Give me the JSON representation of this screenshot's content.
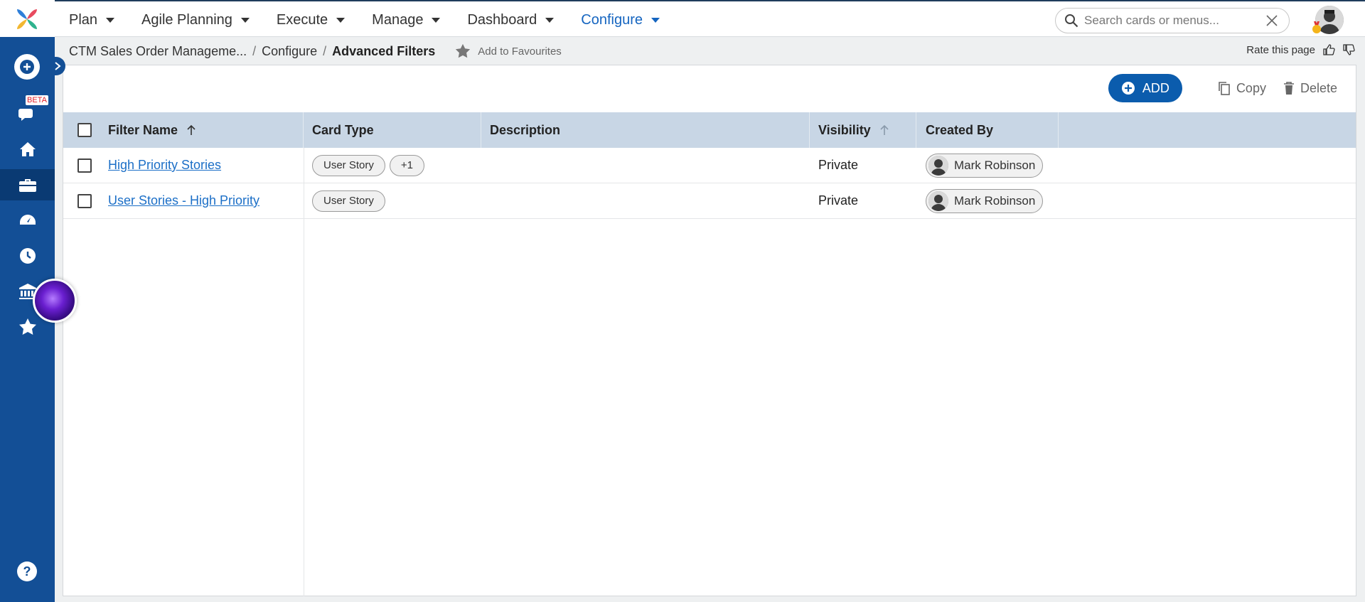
{
  "nav": {
    "menu": [
      {
        "label": "Plan",
        "active": false
      },
      {
        "label": "Agile Planning",
        "active": false
      },
      {
        "label": "Execute",
        "active": false
      },
      {
        "label": "Manage",
        "active": false
      },
      {
        "label": "Dashboard",
        "active": false
      },
      {
        "label": "Configure",
        "active": true
      }
    ],
    "search": {
      "placeholder": "Search cards or menus..."
    }
  },
  "sidebar": {
    "beta_label": "BETA",
    "icons": [
      "add-circle-icon",
      "chat-bubbles-icon",
      "home-icon",
      "briefcase-icon",
      "dashboard-gauge-icon",
      "clock-icon",
      "bank-icon",
      "star-icon",
      "help-icon"
    ],
    "active_icon": "briefcase-icon",
    "help_label": "?"
  },
  "breadcrumb": {
    "items": [
      "CTM Sales Order Manageme...",
      "Configure",
      "Advanced Filters"
    ],
    "favourite_label": "Add to Favourites",
    "rate_label": "Rate this page"
  },
  "toolbar": {
    "add_label": "ADD",
    "copy_label": "Copy",
    "delete_label": "Delete"
  },
  "table": {
    "columns": [
      "Filter Name",
      "Card Type",
      "Description",
      "Visibility",
      "Created By"
    ],
    "rows": [
      {
        "filter_name": "High Priority Stories",
        "card_type": "User Story",
        "extra": "+1",
        "description": "",
        "visibility": "Private",
        "created_by": "Mark Robinson"
      },
      {
        "filter_name": "User Stories - High Priority",
        "card_type": "User Story",
        "extra": "",
        "description": "",
        "visibility": "Private",
        "created_by": "Mark Robinson"
      }
    ]
  },
  "colors": {
    "sidebar": "#134f96",
    "accent": "#0b5cad",
    "header_row": "#c8d6e5",
    "link": "#1c6fc7"
  }
}
